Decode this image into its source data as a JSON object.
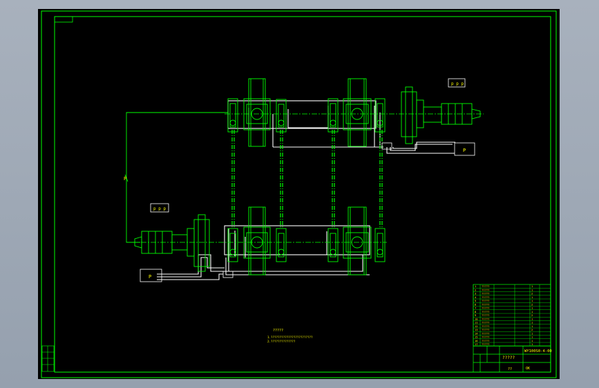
{
  "colors": {
    "background": "#000000",
    "frame": "#00ff00",
    "pipe": "#ffffff",
    "component": "#00ff00",
    "text": "#ffff00"
  },
  "labels": {
    "top_tag": "p p p",
    "mid_tag": "p p p",
    "box_tag_top": "P",
    "box_tag_bottom": "P",
    "side_tag": "P"
  },
  "notes": {
    "heading": "?????",
    "line1": "1.????????????????????????",
    "line2": "2.??????????????"
  },
  "title_block": {
    "drawing_number": "WY100S0-4-00",
    "title": "?????",
    "small": "??",
    "ok": "OK"
  },
  "bom_rows": [
    {
      "c1": "1",
      "c2": "?????",
      "c3": "1"
    },
    {
      "c1": "2",
      "c2": "?????",
      "c3": "1"
    },
    {
      "c1": "3",
      "c2": "?????",
      "c3": "2"
    },
    {
      "c1": "4",
      "c2": "?????",
      "c3": "1"
    },
    {
      "c1": "5",
      "c2": "?????",
      "c3": "1"
    },
    {
      "c1": "6",
      "c2": "?????",
      "c3": "2"
    },
    {
      "c1": "7",
      "c2": "?????",
      "c3": "1"
    },
    {
      "c1": "8",
      "c2": "?????",
      "c3": "1"
    },
    {
      "c1": "9",
      "c2": "?????",
      "c3": "2"
    },
    {
      "c1": "10",
      "c2": "?????",
      "c3": "1"
    },
    {
      "c1": "11",
      "c2": "?????",
      "c3": "1"
    },
    {
      "c1": "12",
      "c2": "?????",
      "c3": "1"
    },
    {
      "c1": "13",
      "c2": "?????",
      "c3": "2"
    },
    {
      "c1": "14",
      "c2": "?????",
      "c3": "1"
    },
    {
      "c1": "15",
      "c2": "?????",
      "c3": "1"
    },
    {
      "c1": "16",
      "c2": "?????",
      "c3": "1"
    },
    {
      "c1": "17",
      "c2": "?????",
      "c3": "1"
    }
  ]
}
